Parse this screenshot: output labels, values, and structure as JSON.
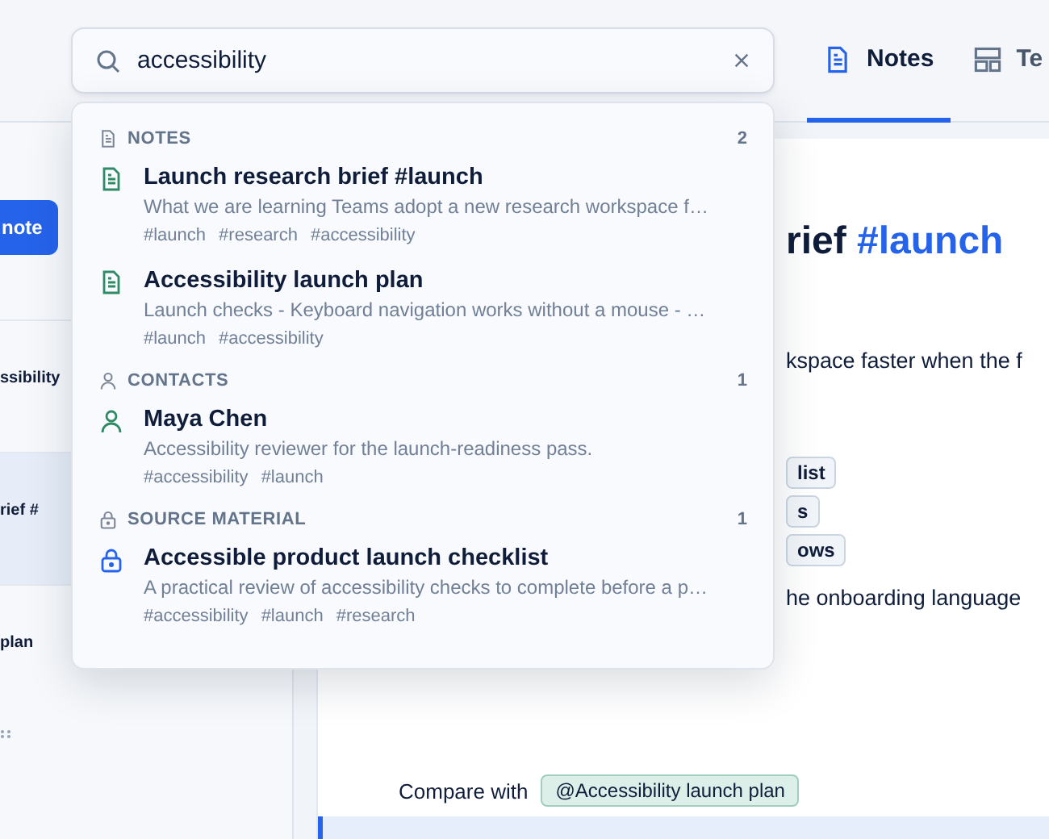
{
  "search": {
    "value": "accessibility"
  },
  "tabs": [
    {
      "label": "Notes",
      "selected": true
    },
    {
      "label": "Te",
      "selected": false
    }
  ],
  "sidebar": {
    "button": "note",
    "items": [
      {
        "label": "ssibility",
        "selected": false
      },
      {
        "label": "rief #",
        "selected": true
      },
      {
        "label": "plan",
        "selected": false
      }
    ]
  },
  "editor": {
    "heading": "rief",
    "heading_tag": "#launch",
    "text": "kspace faster when the f",
    "chips": [
      "list",
      "s",
      "ows"
    ],
    "line": "he onboarding language",
    "compare_label": "Compare with",
    "compare_chip": "@Accessibility launch plan"
  },
  "results": [
    {
      "kind": "note",
      "title": "NOTES",
      "count": "2",
      "items": [
        {
          "title": "Launch research brief #launch",
          "snippet": "What we are learning Teams adopt a new research workspace f…",
          "tags": [
            "#launch",
            "#research",
            "#accessibility"
          ]
        },
        {
          "title": "Accessibility launch plan",
          "snippet": "Launch checks - Keyboard navigation works without a mouse - …",
          "tags": [
            "#launch",
            "#accessibility"
          ]
        }
      ]
    },
    {
      "kind": "contact",
      "title": "CONTACTS",
      "count": "1",
      "items": [
        {
          "title": "Maya Chen",
          "snippet": "Accessibility reviewer for the launch-readiness pass.",
          "tags": [
            "#accessibility",
            "#launch"
          ]
        }
      ]
    },
    {
      "kind": "source",
      "title": "SOURCE MATERIAL",
      "count": "1",
      "items": [
        {
          "title": "Accessible product launch checklist",
          "snippet": "A practical review of accessibility checks to complete before a p…",
          "tags": [
            "#accessibility",
            "#launch",
            "#research"
          ]
        }
      ]
    }
  ]
}
